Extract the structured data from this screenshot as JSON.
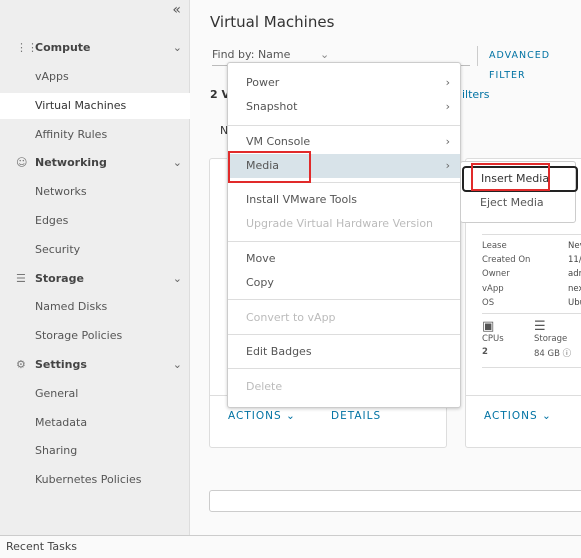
{
  "sidebar": {
    "collapse_icon": "double-chevron-left",
    "sections": [
      {
        "label": "Compute",
        "icon": "grid-icon",
        "items": [
          "vApps",
          "Virtual Machines",
          "Affinity Rules"
        ]
      },
      {
        "label": "Networking",
        "icon": "network-icon",
        "items": [
          "Networks",
          "Edges",
          "Security"
        ]
      },
      {
        "label": "Storage",
        "icon": "database-icon",
        "items": [
          "Named Disks",
          "Storage Policies"
        ]
      },
      {
        "label": "Settings",
        "icon": "gear-icon",
        "items": [
          "General",
          "Metadata",
          "Sharing",
          "Kubernetes Policies"
        ]
      }
    ],
    "active": "Virtual Machines"
  },
  "main": {
    "title": "Virtual Machines",
    "find_by_label": "Find by:",
    "find_by_value": "Name",
    "advanced_filter": "ADVANCED FILTER",
    "count_text": "2 V",
    "filters_text": "ilters",
    "tab_fragment": "N",
    "card1": {
      "actions": "ACTIONS",
      "details": "DETAILS"
    },
    "card2": {
      "actions": "ACTIONS",
      "props": [
        "Lease",
        "Created On",
        "Owner",
        "vApp",
        "OS"
      ],
      "values": [
        "Nev",
        "11/0",
        "adm",
        "nex",
        "Ubu"
      ],
      "cpus_label": "CPUs",
      "cpus_value": "2",
      "storage_label": "Storage",
      "storage_value": "84 GB"
    }
  },
  "context_menu": {
    "items": [
      {
        "label": "Power",
        "submenu": true,
        "disabled": false
      },
      {
        "label": "Snapshot",
        "submenu": true,
        "disabled": false
      },
      {
        "label": "VM Console",
        "submenu": true,
        "disabled": false
      },
      {
        "label": "Media",
        "submenu": true,
        "disabled": false,
        "highlighted": true
      },
      {
        "label": "Install VMware Tools",
        "disabled": false
      },
      {
        "label": "Upgrade Virtual Hardware Version",
        "disabled": true
      },
      {
        "label": "Move",
        "disabled": false
      },
      {
        "label": "Copy",
        "disabled": false
      },
      {
        "label": "Convert to vApp",
        "disabled": true
      },
      {
        "label": "Edit Badges",
        "disabled": false
      },
      {
        "label": "Delete",
        "disabled": true
      }
    ]
  },
  "submenu": {
    "items": [
      "Insert Media",
      "Eject Media"
    ]
  },
  "footer": {
    "recent_tasks": "Recent Tasks"
  },
  "colors": {
    "accent": "#0072a3",
    "highlight_box": "#e12a2a",
    "menu_hover": "#d8e3e9"
  }
}
